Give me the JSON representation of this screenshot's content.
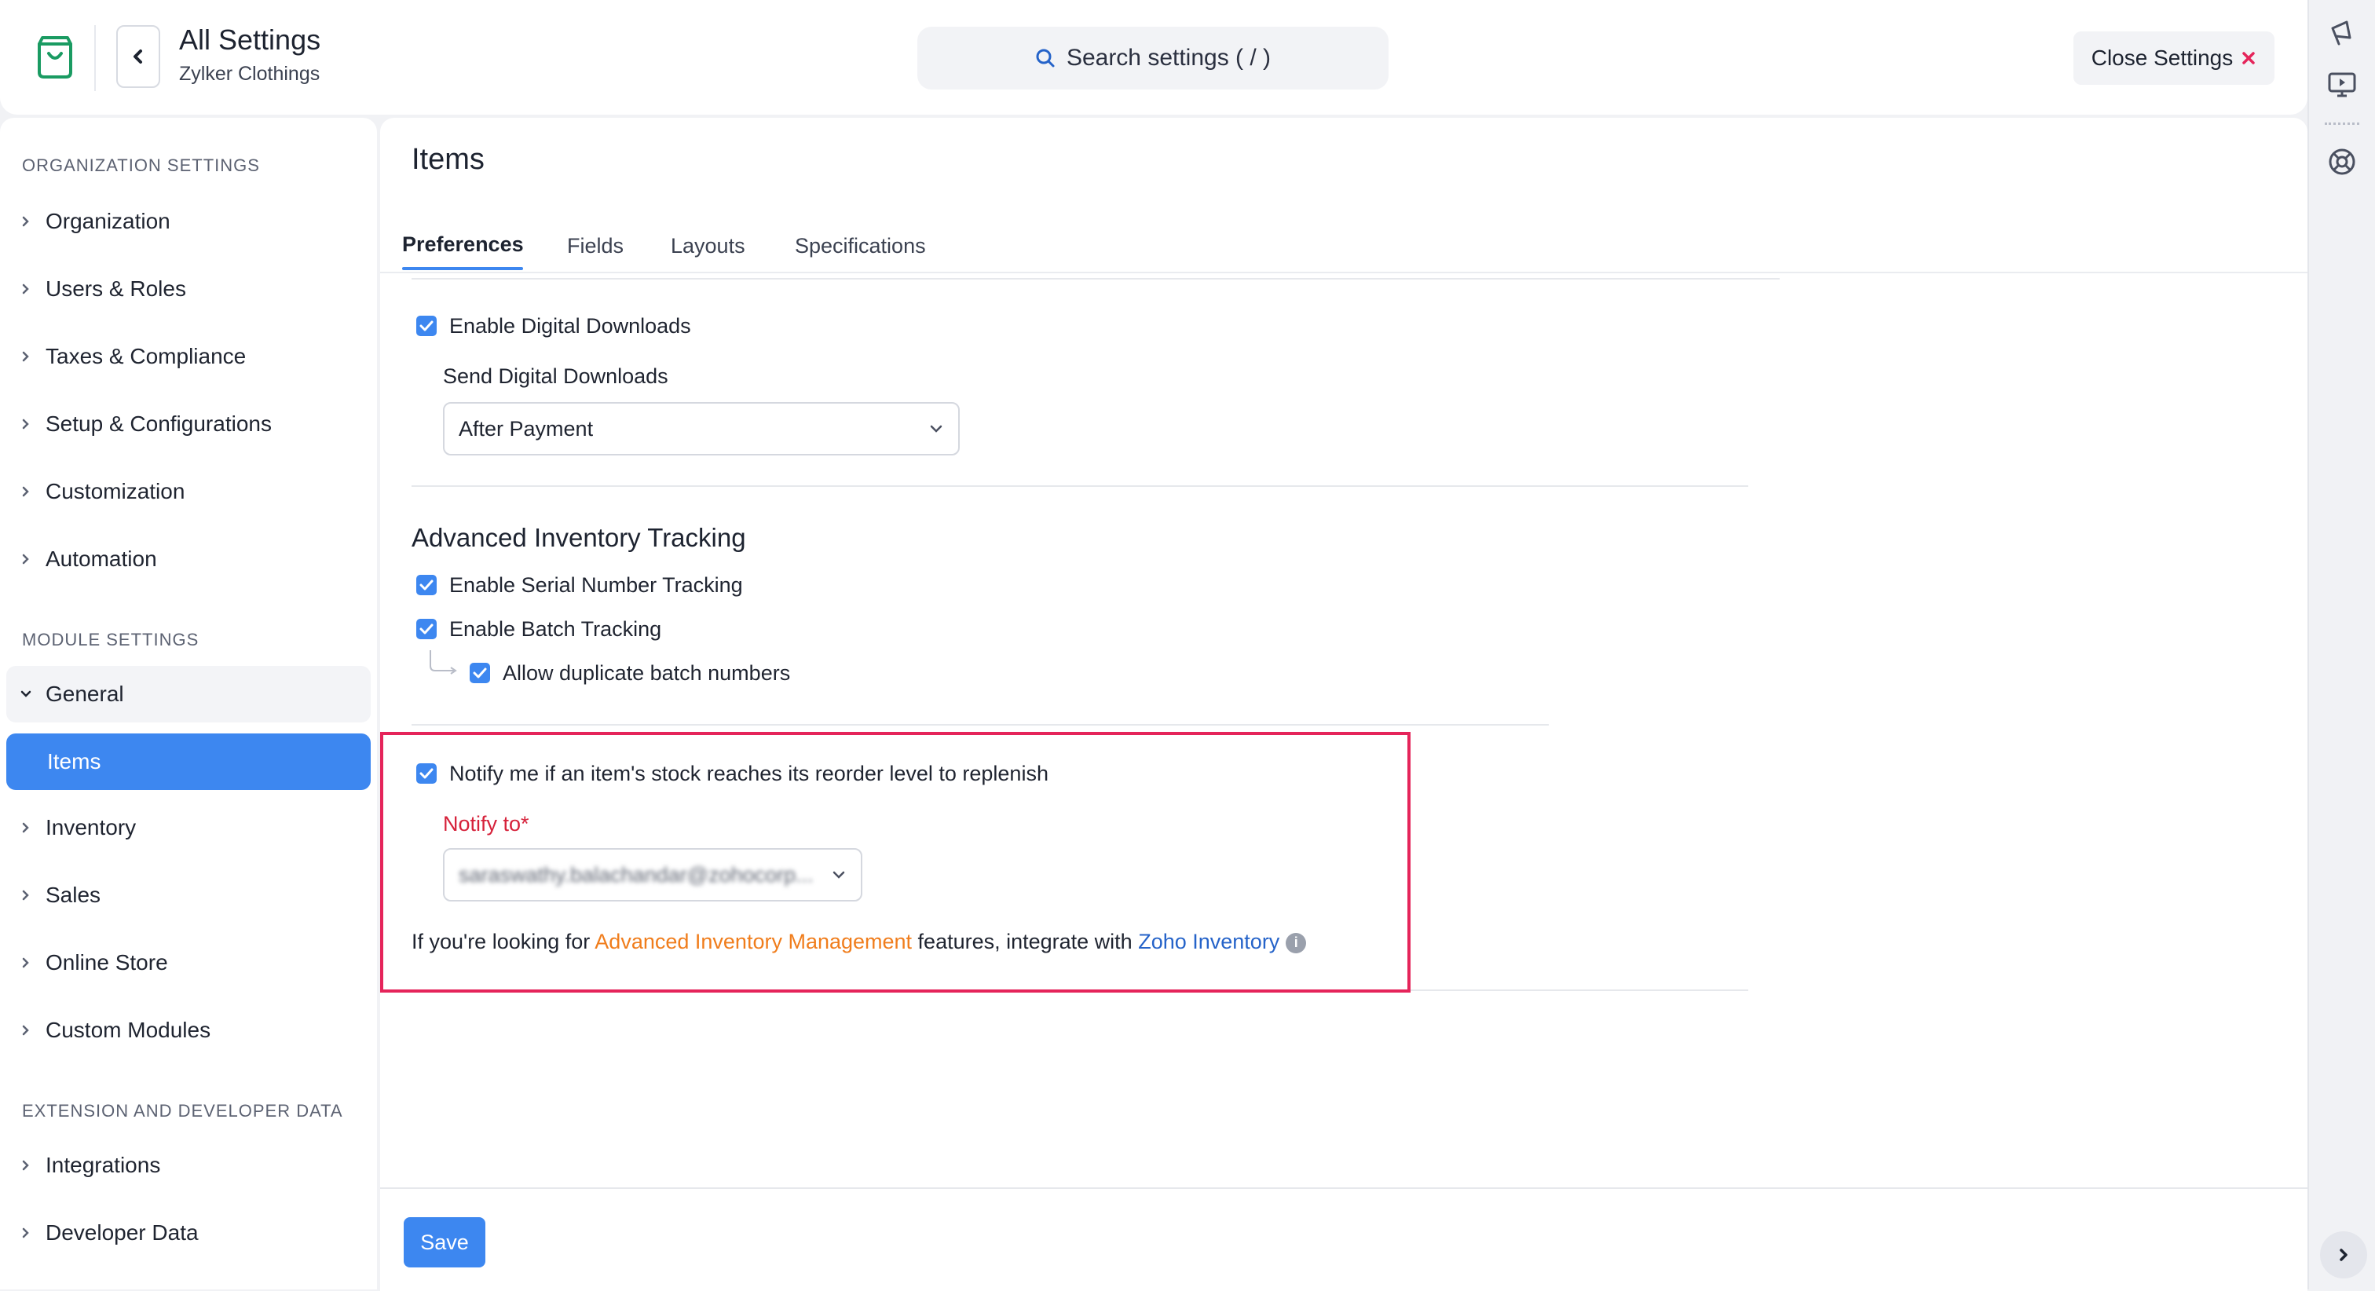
{
  "header": {
    "title": "All Settings",
    "subtitle": "Zylker Clothings",
    "search_placeholder": "Search settings ( / )",
    "close_label": "Close Settings"
  },
  "sidebar": {
    "organization_heading": "ORGANIZATION SETTINGS",
    "organization_items": [
      "Organization",
      "Users & Roles",
      "Taxes & Compliance",
      "Setup & Configurations",
      "Customization",
      "Automation"
    ],
    "module_heading": "MODULE SETTINGS",
    "general_label": "General",
    "active_item": "Items",
    "module_items": [
      "Inventory",
      "Sales",
      "Online Store",
      "Custom Modules"
    ],
    "extension_heading": "EXTENSION AND DEVELOPER DATA",
    "extension_items": [
      "Integrations",
      "Developer Data"
    ]
  },
  "main": {
    "title": "Items",
    "tabs": [
      "Preferences",
      "Fields",
      "Layouts",
      "Specifications"
    ],
    "active_tab": "Preferences",
    "digital": {
      "enable_label": "Enable Digital Downloads",
      "enabled": true,
      "send_label": "Send Digital Downloads",
      "send_value": "After Payment"
    },
    "advanced": {
      "title": "Advanced Inventory Tracking",
      "serial_label": "Enable Serial Number Tracking",
      "serial_enabled": true,
      "batch_label": "Enable Batch Tracking",
      "batch_enabled": true,
      "duplicate_label": "Allow duplicate batch numbers",
      "duplicate_enabled": true
    },
    "notify": {
      "label": "Notify me if an item's stock reaches its reorder level to replenish",
      "enabled": true,
      "notify_to_label": "Notify to*",
      "notify_to_value": "saraswathy.balachandar@zohocorp..."
    },
    "integrate": {
      "prefix": "If you're looking for ",
      "link1": "Advanced Inventory Management",
      "middle": " features, integrate with ",
      "link2": "Zoho Inventory"
    },
    "save_label": "Save"
  },
  "colors": {
    "accent": "#3d87f0",
    "highlight_border": "#e5245a",
    "required": "#d6213a",
    "link_orange": "#f07d1c",
    "link_blue": "#2563c9"
  },
  "icons": [
    "shopping-bag-logo-icon",
    "chevron-left-icon",
    "search-icon",
    "close-x-icon",
    "megaphone-icon",
    "video-tutorial-icon",
    "help-lifebuoy-icon",
    "chevron-right-icon",
    "chevron-down-icon",
    "check-icon",
    "info-icon"
  ]
}
